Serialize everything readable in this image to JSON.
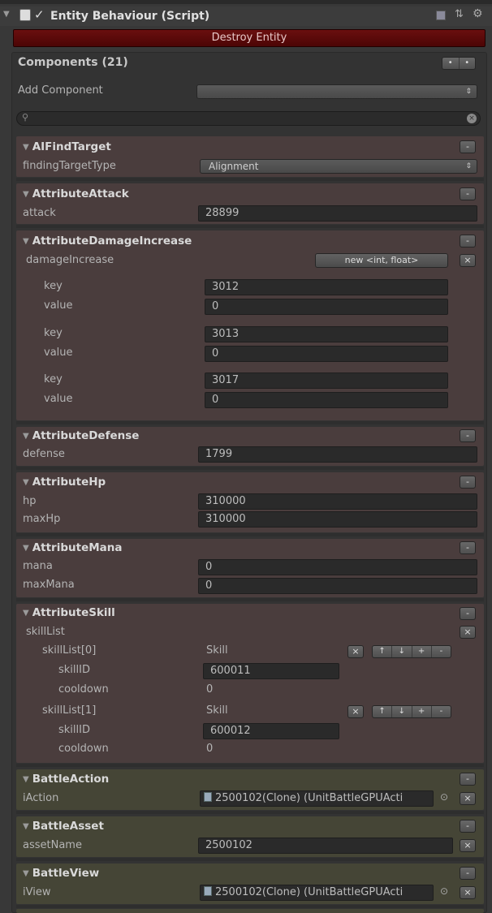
{
  "header": {
    "title": "Entity Behaviour (Script)",
    "destroy_label": "Destroy Entity"
  },
  "components": {
    "title": "Components (21)",
    "add_label": "Add Component",
    "add_value": "",
    "search_placeholder": ""
  },
  "afind": {
    "name": "AIFindTarget",
    "field_label": "findingTargetType",
    "field_value": "Alignment"
  },
  "attack": {
    "name": "AttributeAttack",
    "field_label": "attack",
    "field_value": "28899"
  },
  "dmg": {
    "name": "AttributeDamageIncrease",
    "field_label": "damageIncrease",
    "new_button": "new <int, float>",
    "entries": [
      {
        "key_label": "key",
        "key": "3012",
        "value_label": "value",
        "value": "0"
      },
      {
        "key_label": "key",
        "key": "3013",
        "value_label": "value",
        "value": "0"
      },
      {
        "key_label": "key",
        "key": "3017",
        "value_label": "value",
        "value": "0"
      }
    ]
  },
  "defense": {
    "name": "AttributeDefense",
    "field_label": "defense",
    "field_value": "1799"
  },
  "hp": {
    "name": "AttributeHp",
    "hp_label": "hp",
    "hp": "310000",
    "max_label": "maxHp",
    "max": "310000"
  },
  "mana": {
    "name": "AttributeMana",
    "mana_label": "mana",
    "mana": "0",
    "max_label": "maxMana",
    "max": "0"
  },
  "skill": {
    "name": "AttributeSkill",
    "list_label": "skillList",
    "items": [
      {
        "label": "skillList[0]",
        "type": "Skill",
        "id_label": "skillID",
        "id": "600011",
        "cd_label": "cooldown",
        "cd": "0"
      },
      {
        "label": "skillList[1]",
        "type": "Skill",
        "id_label": "skillID",
        "id": "600012",
        "cd_label": "cooldown",
        "cd": "0"
      }
    ]
  },
  "bact": {
    "name": "BattleAction",
    "field_label": "iAction",
    "field_value": "2500102(Clone) (UnitBattleGPUActi"
  },
  "basset": {
    "name": "BattleAsset",
    "field_label": "assetName",
    "field_value": "2500102"
  },
  "bview": {
    "name": "BattleView",
    "field_label": "iView",
    "field_value": "2500102(Clone) (UnitBattleGPUActi"
  },
  "glyphs": {
    "minus": "-",
    "x": "×",
    "up": "↑",
    "down": "↓",
    "plus": "+",
    "tri": "▼",
    "dot": "⊙"
  },
  "colors": {
    "red_panel": "#4a3d3d",
    "green_panel": "#454536",
    "destroy_bar": "#5a0a0a"
  }
}
